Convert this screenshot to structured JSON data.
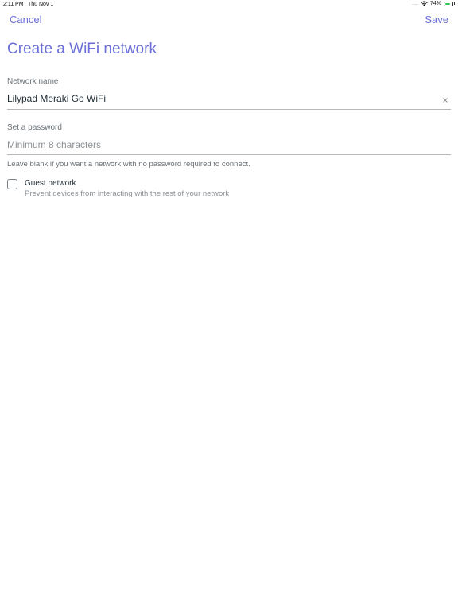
{
  "status_bar": {
    "time": "2:11 PM",
    "date": "Thu Nov 1",
    "signal": "....",
    "battery_percent": "74%",
    "battery_level": 0.74,
    "icons": [
      "wifi-icon",
      "battery-icon"
    ]
  },
  "nav": {
    "cancel_label": "Cancel",
    "save_label": "Save"
  },
  "title": "Create a WiFi network",
  "network_name": {
    "label": "Network name",
    "value": "Lilypad Meraki Go WiFi",
    "clear_icon": "close-icon"
  },
  "password": {
    "label": "Set a password",
    "placeholder": "Minimum 8 characters",
    "value": "",
    "helper": "Leave blank if you want a network with no password required to connect."
  },
  "guest_network": {
    "label": "Guest network",
    "description": "Prevent devices from interacting with the rest of your network",
    "checked": false
  },
  "colors": {
    "accent": "#6b6fd6",
    "text": "#1f2b33",
    "muted": "#6b7177",
    "divider": "#b5b9bd",
    "battery": "#35c759"
  }
}
